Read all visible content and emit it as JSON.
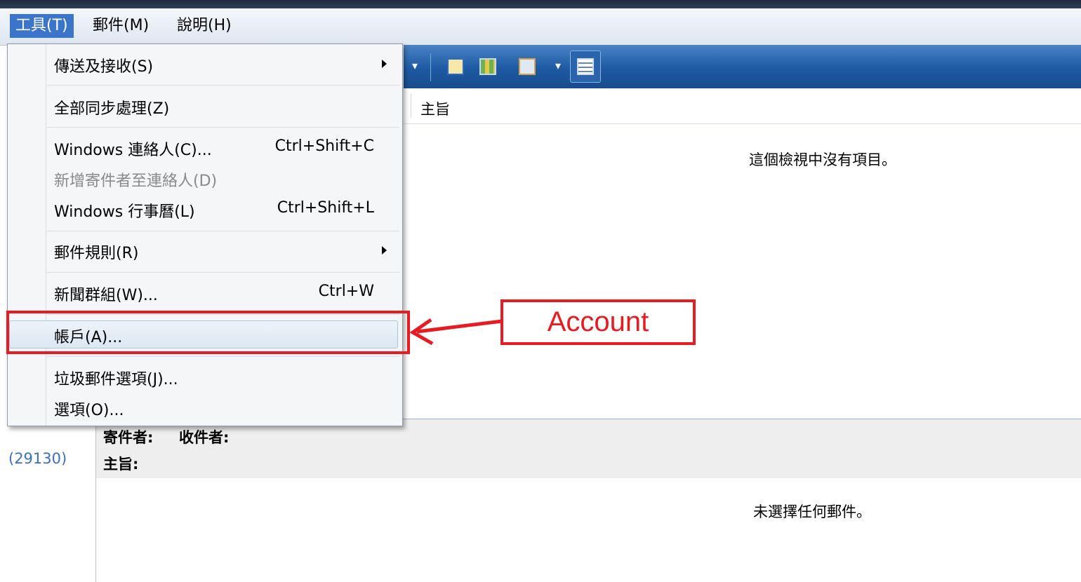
{
  "menubar": {
    "tools": "工具(T)",
    "mail": "郵件(M)",
    "help": "說明(H)"
  },
  "column_header": {
    "subject": "主旨"
  },
  "message_list": {
    "empty_text": "這個檢視中沒有項目。"
  },
  "folder_pane": {
    "count": "(29130)"
  },
  "preview": {
    "from_label": "寄件者:",
    "to_label": "收件者:",
    "subject_label": "主旨:",
    "empty_text": "未選擇任何郵件。"
  },
  "tools_menu": {
    "items": [
      {
        "label": "傳送及接收(S)",
        "shortcut": "",
        "submenu": true,
        "disabled": false
      },
      {
        "label": "全部同步處理(Z)",
        "shortcut": "",
        "submenu": false,
        "disabled": false
      },
      {
        "label": "Windows 連絡人(C)...",
        "shortcut": "Ctrl+Shift+C",
        "submenu": false,
        "disabled": false
      },
      {
        "label": "新增寄件者至連絡人(D)",
        "shortcut": "",
        "submenu": false,
        "disabled": true
      },
      {
        "label": "Windows 行事曆(L)",
        "shortcut": "Ctrl+Shift+L",
        "submenu": false,
        "disabled": false
      },
      {
        "label": "郵件規則(R)",
        "shortcut": "",
        "submenu": true,
        "disabled": false
      },
      {
        "label": "新聞群組(W)...",
        "shortcut": "Ctrl+W",
        "submenu": false,
        "disabled": false
      },
      {
        "label": "帳戶(A)...",
        "shortcut": "",
        "submenu": false,
        "disabled": false,
        "highlighted": true
      },
      {
        "label": "垃圾郵件選項(J)...",
        "shortcut": "",
        "submenu": false,
        "disabled": false
      },
      {
        "label": "選項(O)...",
        "shortcut": "",
        "submenu": false,
        "disabled": false
      }
    ]
  },
  "annotation": {
    "label": "Account",
    "color": "#e81b23"
  },
  "colors": {
    "toolbar": "#1d5aa3",
    "menu_active": "#3a75c9",
    "count_link": "#3b6fc1"
  }
}
